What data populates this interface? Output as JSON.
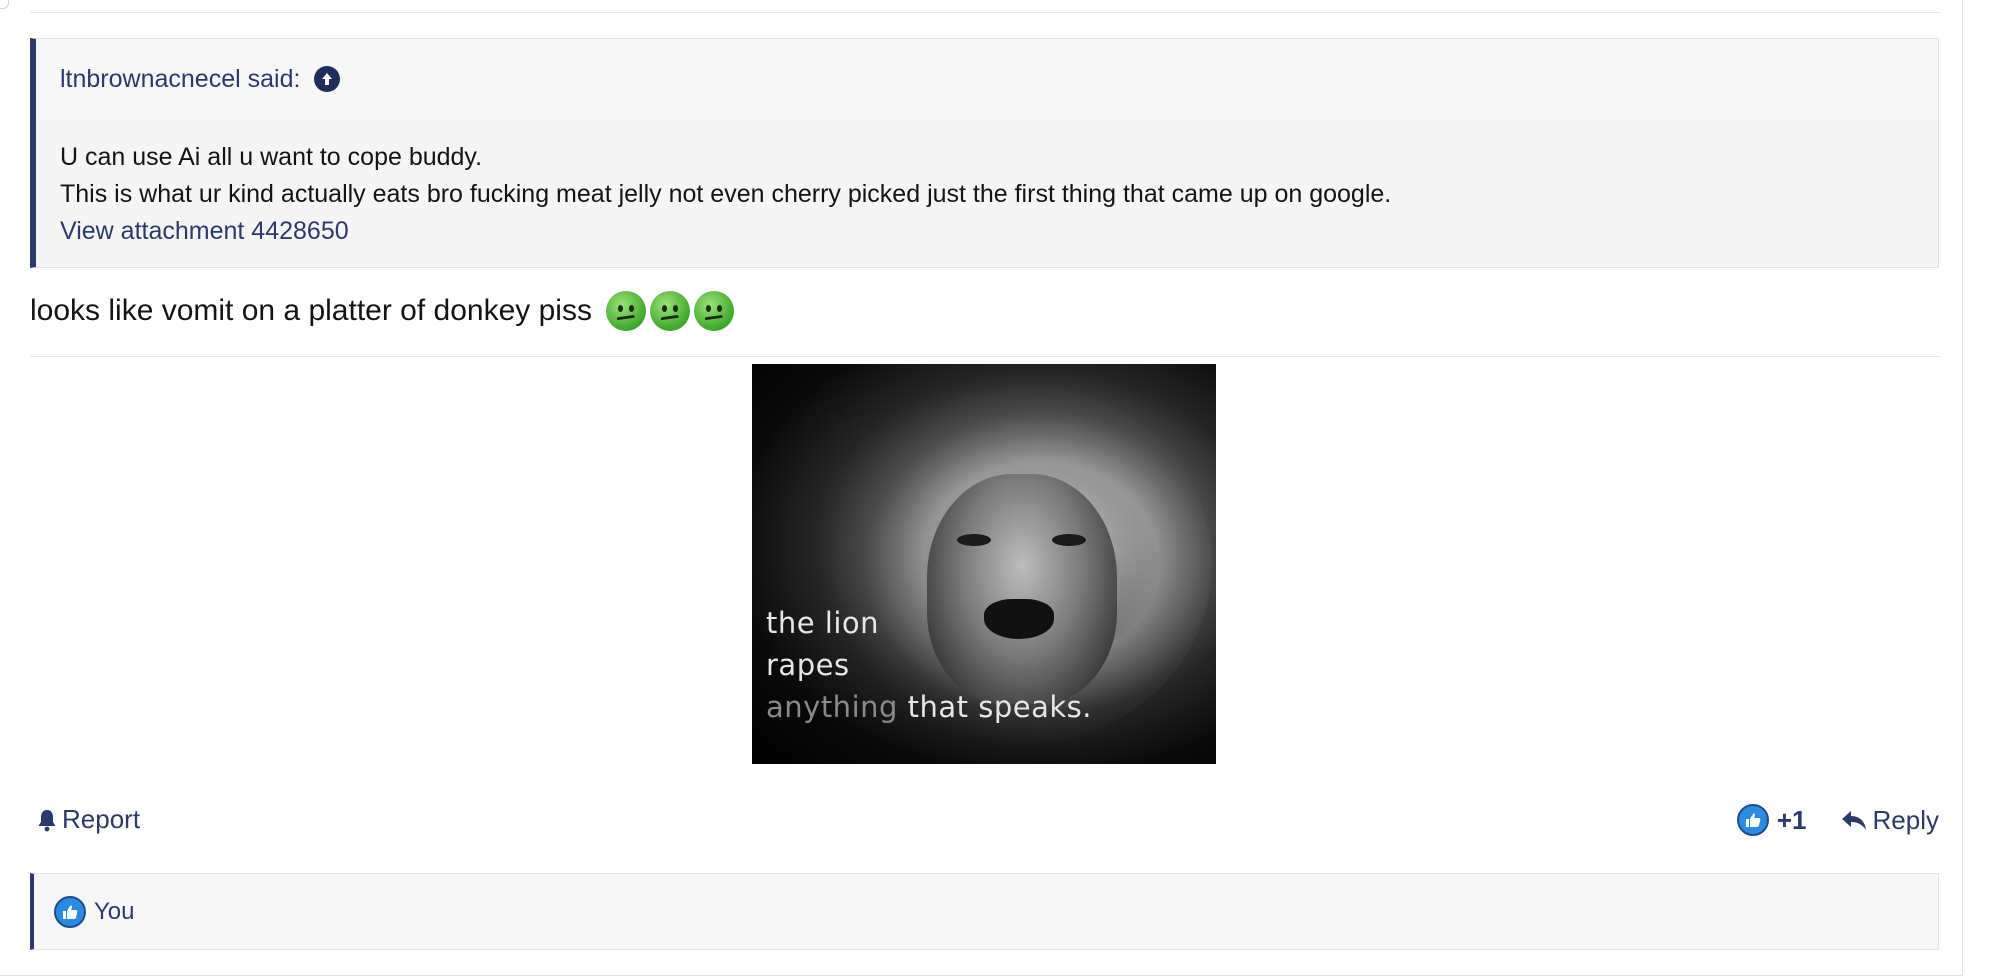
{
  "quote": {
    "author_said": "ltnbrownacnecel said:",
    "up_icon": "arrow-up-circle-icon",
    "line1": "U can use Ai all u want to cope buddy.",
    "line2": "This is what ur kind actually eats bro fucking meat jelly not even cherry picked just the first thing that came up on google.",
    "attachment_link": "View attachment 4428650"
  },
  "message": {
    "text": "looks like vomit on a platter of donkey piss",
    "emoji": "nauseated-face-icon"
  },
  "image": {
    "caption_line1": "the lion",
    "caption_line2": "rapes",
    "caption_line3_dim": "anything",
    "caption_line3": " that speaks."
  },
  "actions": {
    "report_label": "Report",
    "like_count": "+1",
    "reply_label": "Reply"
  },
  "reactions": {
    "label": "You"
  },
  "colors": {
    "accent": "#2b3a6b",
    "like_blue": "#2a8be0"
  }
}
